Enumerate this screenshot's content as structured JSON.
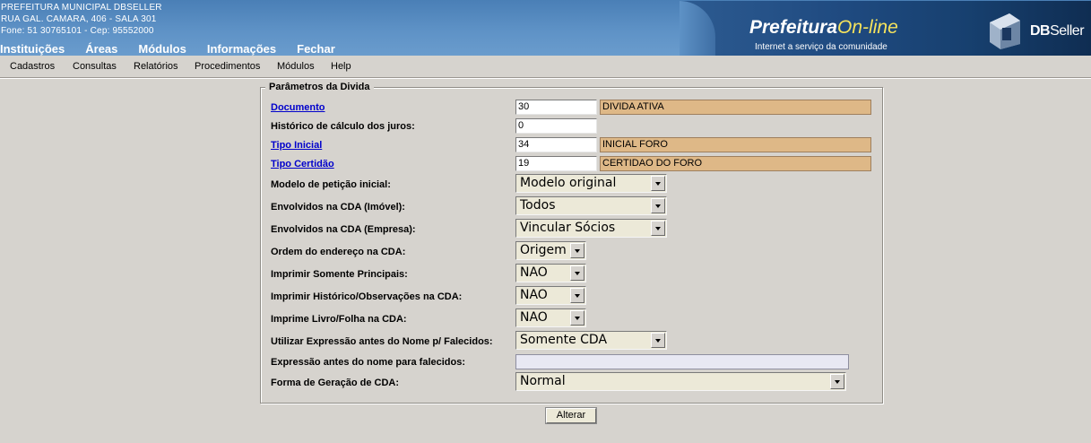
{
  "header": {
    "org_name": "PREFEITURA MUNICIPAL DBSELLER",
    "address": "RUA GAL. CAMARA, 406 - SALA 301",
    "contact": "Fone: 51 30765101  -  Cep: 95552000",
    "menu": [
      "Instituições",
      "Áreas",
      "Módulos",
      "Informações",
      "Fechar"
    ],
    "brand_main": "Prefeitura",
    "brand_accent": "On-line",
    "brand_tagline": "Internet a serviço da comunidade",
    "logo_bold": "DB",
    "logo_light": "Seller"
  },
  "menubar": [
    "Cadastros",
    "Consultas",
    "Relatórios",
    "Procedimentos",
    "Módulos",
    "Help"
  ],
  "form": {
    "legend": "Parâmetros da Divida",
    "documento": {
      "label": "Documento",
      "code": "30",
      "desc": "DIVIDA ATIVA"
    },
    "historico": {
      "label": "Histórico de cálculo dos juros:",
      "value": "0"
    },
    "tipo_inicial": {
      "label": "Tipo Inicial",
      "code": "34",
      "desc": "INICIAL FORO"
    },
    "tipo_certidao": {
      "label": "Tipo Certidão",
      "code": "19",
      "desc": "CERTIDAO DO FORO"
    },
    "modelo_peticao": {
      "label": "Modelo de petição inicial:",
      "value": "Modelo original"
    },
    "envolvidos_imovel": {
      "label": "Envolvidos na CDA (Imóvel):",
      "value": "Todos"
    },
    "envolvidos_empresa": {
      "label": "Envolvidos na CDA (Empresa):",
      "value": "Vincular Sócios"
    },
    "ordem_endereco": {
      "label": "Ordem do endereço na CDA:",
      "value": "Origem"
    },
    "imprimir_principais": {
      "label": "Imprimir Somente Principais:",
      "value": "NAO"
    },
    "imprimir_historico": {
      "label": "Imprimir Histórico/Observações na CDA:",
      "value": "NAO"
    },
    "imprime_livro": {
      "label": "Imprime Livro/Folha na CDA:",
      "value": "NAO"
    },
    "utilizar_expressao": {
      "label": "Utilizar Expressão antes do Nome p/ Falecidos:",
      "value": "Somente CDA"
    },
    "expressao_falecidos": {
      "label": "Expressão antes do nome para falecidos:",
      "value": ""
    },
    "forma_geracao": {
      "label": "Forma de Geração de CDA:",
      "value": "Normal"
    },
    "submit_label": "Alterar"
  }
}
